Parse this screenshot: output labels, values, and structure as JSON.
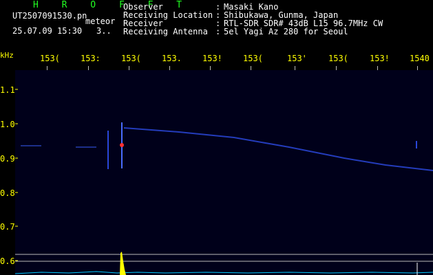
{
  "header": {
    "title": "H R O F F T",
    "filename": "UT2507091530.pn",
    "tag": "meteor",
    "datetime": "25.07.09 15:30",
    "count": "3..",
    "info": [
      {
        "key": "Observer",
        "value": "Masaki Kano"
      },
      {
        "key": "Receiving Location",
        "value": "Shibukawa, Gunma, Japan"
      },
      {
        "key": "Receiver",
        "value": "RTL-SDR SDR# 43dB L15 96.7MHz CW"
      },
      {
        "key": "Receiving Antenna",
        "value": "5el Yagi Az 280 for Seoul"
      }
    ],
    "separator": ":"
  },
  "axes": {
    "unit": "kHz",
    "x_ticks": [
      "153(",
      "153:",
      "153(",
      "153.",
      "153!",
      "153(",
      "153'",
      "153(",
      "153!",
      "1540"
    ],
    "y_ticks": [
      "1.1",
      "1.0",
      "0.9",
      "0.8",
      "0.7",
      "0.6"
    ]
  },
  "colors": {
    "label": "#ffff00",
    "title": "#22ff22",
    "trace": "#2a46d8",
    "level": "#00ccff",
    "burst": "#ffff00"
  }
}
